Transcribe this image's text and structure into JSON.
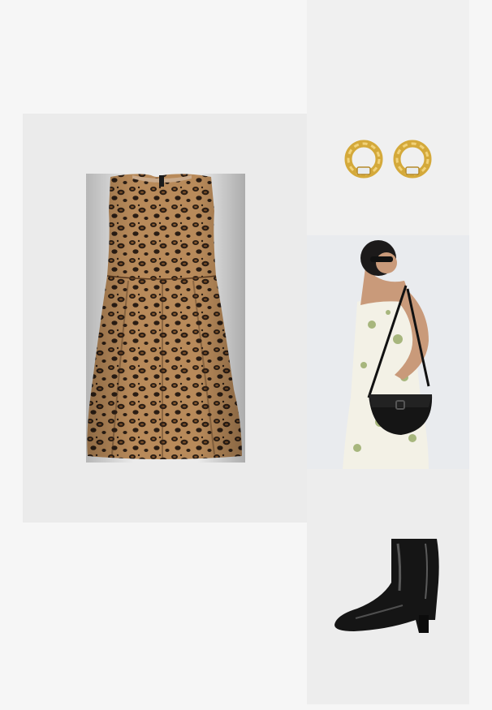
{
  "outfit": {
    "items": [
      {
        "id": "dress",
        "icon": "leopard-dress-icon",
        "pattern": "leopard print"
      },
      {
        "id": "earrings",
        "icon": "gold-hoop-earrings-icon"
      },
      {
        "id": "bag",
        "icon": "black-crossbody-bag-icon"
      },
      {
        "id": "boot",
        "icon": "black-patent-ankle-boot-icon"
      }
    ],
    "colors": {
      "page_bg": "#f6f6f6",
      "tile_bg": "#ebebeb",
      "leopard_base": "#b88a5a",
      "leopard_spot": "#2a1d14",
      "gold": "#d4a93a",
      "black": "#151515"
    }
  }
}
